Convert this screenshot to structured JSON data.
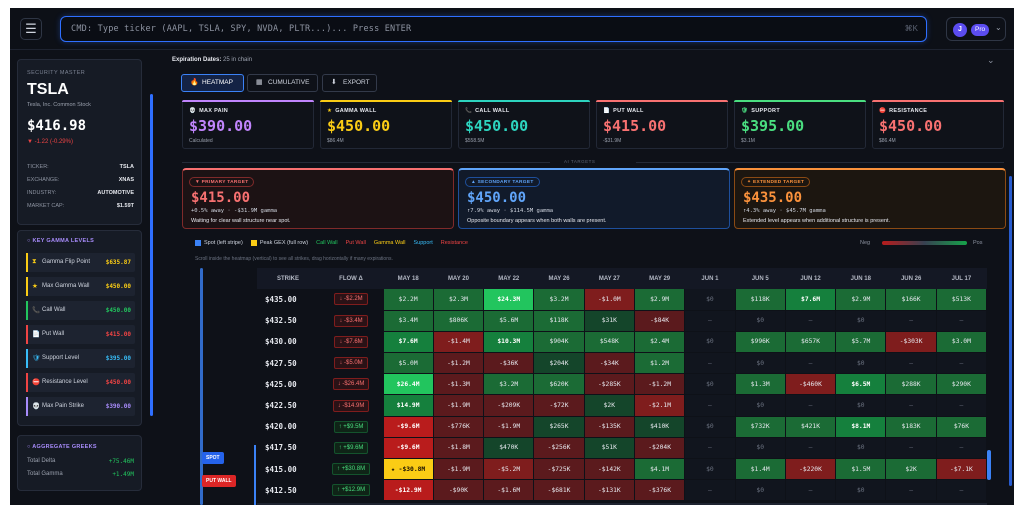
{
  "topbar": {
    "menu_icon": "hamburger-icon",
    "cmd_placeholder": "CMD: Type ticker (AAPL, TSLA, SPY, NVDA, PLTR...)... Press ENTER",
    "cmd_shortcut": "⌘K",
    "avatar": "J",
    "plan": "Pro"
  },
  "security": {
    "heading": "SECURITY MASTER",
    "ticker": "TSLA",
    "company": "Tesla, Inc. Common Stock",
    "price": "$416.98",
    "change": "▼ -1.22 (-0.29%)",
    "rows": [
      {
        "label": "TICKER:",
        "value": "TSLA"
      },
      {
        "label": "EXCHANGE:",
        "value": "XNAS"
      },
      {
        "label": "INDUSTRY:",
        "value": "AUTOMOTIVE"
      },
      {
        "label": "MARKET CAP:",
        "value": "$1.59T"
      }
    ]
  },
  "levels": {
    "heading": "KEY GAMMA LEVELS",
    "items": [
      {
        "icon": "⧗",
        "label": "Gamma Flip Point",
        "value": "$635.87",
        "color": "#facc15"
      },
      {
        "icon": "★",
        "label": "Max Gamma Wall",
        "value": "$450.00",
        "color": "#facc15"
      },
      {
        "icon": "📞",
        "label": "Call Wall",
        "value": "$450.00",
        "color": "#22c55e"
      },
      {
        "icon": "📄",
        "label": "Put Wall",
        "value": "$415.00",
        "color": "#ef4444"
      },
      {
        "icon": "🛡",
        "label": "Support Level",
        "value": "$395.00",
        "color": "#38bdf8"
      },
      {
        "icon": "⛔",
        "label": "Resistance Level",
        "value": "$450.00",
        "color": "#ef4444"
      },
      {
        "icon": "💀",
        "label": "Max Pain Strike",
        "value": "$390.00",
        "color": "#a78bfa"
      }
    ]
  },
  "greeks": {
    "heading": "AGGREGATE GREEKS",
    "rows": [
      {
        "label": "Total Delta",
        "value": "+75.46M"
      },
      {
        "label": "Total Gamma",
        "value": "+1.49M"
      }
    ]
  },
  "main": {
    "exp_label": "Expiration Dates:",
    "exp_value": "25 in chain",
    "tabs": [
      {
        "label": "HEATMAP",
        "icon": "flame-icon"
      },
      {
        "label": "CUMULATIVE",
        "icon": "bar-chart-icon"
      },
      {
        "label": "EXPORT",
        "icon": "export-icon"
      }
    ]
  },
  "cards": [
    {
      "title": "MAX PAIN",
      "icon": "💀",
      "value": "$390.00",
      "sub": "Calculated",
      "color": "#c084fc"
    },
    {
      "title": "GAMMA WALL",
      "icon": "★",
      "value": "$450.00",
      "sub": "$86.4M",
      "color": "#facc15"
    },
    {
      "title": "CALL WALL",
      "icon": "📞",
      "value": "$450.00",
      "sub": "$558.5M",
      "color": "#2dd4bf"
    },
    {
      "title": "PUT WALL",
      "icon": "📄",
      "value": "$415.00",
      "sub": "-$31.9M",
      "color": "#f87171"
    },
    {
      "title": "SUPPORT",
      "icon": "🛡",
      "value": "$395.00",
      "sub": "$3.1M",
      "color": "#4ade80"
    },
    {
      "title": "RESISTANCE",
      "icon": "⛔",
      "value": "$450.00",
      "sub": "$86.4M",
      "color": "#f87171"
    }
  ],
  "ai_divider": "AI TARGETS",
  "targets": [
    {
      "badge": "▼ PRIMARY TARGET",
      "value": "$415.00",
      "meta": "+0.5% away · -$31.9M gamma",
      "desc": "Waiting for clear wall structure near spot.",
      "color": "#f87171",
      "border": "#7f2a2a",
      "bg": "#1c1214"
    },
    {
      "badge": "▲ SECONDARY TARGET",
      "value": "$450.00",
      "meta": "↑7.9% away · $114.5M gamma",
      "desc": "Opposite boundary appears when both walls are present.",
      "color": "#60a5fa",
      "border": "#1e4f9c",
      "bg": "#111a2a"
    },
    {
      "badge": "✦ EXTENDED TARGET",
      "value": "$435.00",
      "meta": "↑4.3% away · $45.7M gamma",
      "desc": "Extended level appears when additional structure is present.",
      "color": "#fb923c",
      "border": "#8a4a14",
      "bg": "#1c1610"
    }
  ],
  "legend": {
    "items": [
      {
        "label": "Spot (left stripe)",
        "color": "#3b82f6",
        "text": "#cfd4de"
      },
      {
        "label": "Peak GEX (full row)",
        "color": "#facc15",
        "text": "#cfd4de"
      },
      {
        "label": "Call Wall",
        "color": "",
        "text": "#22c55e"
      },
      {
        "label": "Put Wall",
        "color": "",
        "text": "#ef4444"
      },
      {
        "label": "Gamma Wall",
        "color": "",
        "text": "#facc15"
      },
      {
        "label": "Support",
        "color": "",
        "text": "#38bdf8"
      },
      {
        "label": "Resistance",
        "color": "",
        "text": "#ef4444"
      }
    ],
    "neg": "Neg",
    "pos": "Pos",
    "hint": "Scroll inside the heatmap (vertical) to see all strikes, drag horizontally if many expirations."
  },
  "markers": {
    "spot": "SPOT",
    "put_wall": "PUT WALL"
  },
  "heatmap": {
    "headers": [
      "STRIKE",
      "FLOW Δ",
      "MAY 18",
      "MAY 20",
      "MAY 22",
      "MAY 26",
      "MAY 27",
      "MAY 29",
      "JUN 1",
      "JUN 5",
      "JUN 12",
      "JUN 18",
      "JUN 26",
      "JUL 17"
    ],
    "rows": [
      {
        "strike": "$435.00",
        "flow": "↓ -$2.2M",
        "flow_dir": "neg",
        "cells": [
          [
            "$2.2M",
            "g2"
          ],
          [
            "$2.3M",
            "g2"
          ],
          [
            "$24.3M",
            "g4"
          ],
          [
            "$3.2M",
            "g2"
          ],
          [
            "-$1.0M",
            "r2"
          ],
          [
            "$2.9M",
            "g2"
          ],
          [
            "$0",
            "n"
          ],
          [
            "$118K",
            "g2"
          ],
          [
            "$7.6M",
            "g3"
          ],
          [
            "$2.9M",
            "g2"
          ],
          [
            "$166K",
            "g2"
          ],
          [
            "$513K",
            "g2"
          ]
        ]
      },
      {
        "strike": "$432.50",
        "flow": "↓ -$3.4M",
        "flow_dir": "neg",
        "cells": [
          [
            "$3.4M",
            "g2"
          ],
          [
            "$806K",
            "g2"
          ],
          [
            "$5.6M",
            "g2"
          ],
          [
            "$118K",
            "g2"
          ],
          [
            "$31K",
            "g1"
          ],
          [
            "-$84K",
            "r1"
          ],
          [
            "—",
            "n"
          ],
          [
            "$0",
            "n"
          ],
          [
            "—",
            "n"
          ],
          [
            "$0",
            "n"
          ],
          [
            "—",
            "n"
          ],
          [
            "—",
            "n"
          ]
        ]
      },
      {
        "strike": "$430.00",
        "flow": "↓ -$7.6M",
        "flow_dir": "neg",
        "cells": [
          [
            "$7.6M",
            "g3"
          ],
          [
            "-$1.4M",
            "r2"
          ],
          [
            "$10.3M",
            "g3"
          ],
          [
            "$904K",
            "g2"
          ],
          [
            "$548K",
            "g2"
          ],
          [
            "$2.4M",
            "g2"
          ],
          [
            "$0",
            "n"
          ],
          [
            "$996K",
            "g2"
          ],
          [
            "$657K",
            "g2"
          ],
          [
            "$5.7M",
            "g2"
          ],
          [
            "-$303K",
            "r2"
          ],
          [
            "$3.0M",
            "g2"
          ]
        ]
      },
      {
        "strike": "$427.50",
        "flow": "↓ -$5.0M",
        "flow_dir": "neg",
        "cells": [
          [
            "$5.0M",
            "g2"
          ],
          [
            "-$1.2M",
            "r1"
          ],
          [
            "-$36K",
            "r1"
          ],
          [
            "$204K",
            "g1"
          ],
          [
            "-$34K",
            "r1"
          ],
          [
            "$1.2M",
            "g2"
          ],
          [
            "—",
            "n"
          ],
          [
            "$0",
            "n"
          ],
          [
            "—",
            "n"
          ],
          [
            "$0",
            "n"
          ],
          [
            "—",
            "n"
          ],
          [
            "—",
            "n"
          ]
        ]
      },
      {
        "strike": "$425.00",
        "flow": "↓ -$26.4M",
        "flow_dir": "neg",
        "cells": [
          [
            "$26.4M",
            "g4"
          ],
          [
            "-$1.3M",
            "r1"
          ],
          [
            "$3.2M",
            "g2"
          ],
          [
            "$620K",
            "g2"
          ],
          [
            "-$285K",
            "r1"
          ],
          [
            "-$1.2M",
            "r1"
          ],
          [
            "$0",
            "n"
          ],
          [
            "$1.3M",
            "g2"
          ],
          [
            "-$460K",
            "r2"
          ],
          [
            "$6.5M",
            "g3"
          ],
          [
            "$288K",
            "g2"
          ],
          [
            "$290K",
            "g2"
          ]
        ]
      },
      {
        "strike": "$422.50",
        "flow": "↓ -$14.9M",
        "flow_dir": "neg",
        "cells": [
          [
            "$14.9M",
            "g3"
          ],
          [
            "-$1.9M",
            "r1"
          ],
          [
            "-$209K",
            "r1"
          ],
          [
            "-$72K",
            "r1"
          ],
          [
            "$2K",
            "g1"
          ],
          [
            "-$2.1M",
            "r2"
          ],
          [
            "—",
            "n"
          ],
          [
            "$0",
            "n"
          ],
          [
            "—",
            "n"
          ],
          [
            "$0",
            "n"
          ],
          [
            "—",
            "n"
          ],
          [
            "—",
            "n"
          ]
        ]
      },
      {
        "strike": "$420.00",
        "flow": "↑ +$9.5M",
        "flow_dir": "pos",
        "cells": [
          [
            "-$9.6M",
            "r3"
          ],
          [
            "-$776K",
            "r1"
          ],
          [
            "-$1.9M",
            "r1"
          ],
          [
            "$265K",
            "g1"
          ],
          [
            "-$135K",
            "r1"
          ],
          [
            "$410K",
            "g1"
          ],
          [
            "$0",
            "n"
          ],
          [
            "$732K",
            "g2"
          ],
          [
            "$421K",
            "g2"
          ],
          [
            "$8.1M",
            "g3"
          ],
          [
            "$183K",
            "g2"
          ],
          [
            "$76K",
            "g2"
          ]
        ]
      },
      {
        "strike": "$417.50",
        "flow": "↑ +$9.6M",
        "flow_dir": "pos",
        "cells": [
          [
            "-$9.6M",
            "r3"
          ],
          [
            "-$1.8M",
            "r1"
          ],
          [
            "$470K",
            "g1"
          ],
          [
            "-$256K",
            "r1"
          ],
          [
            "$51K",
            "g1"
          ],
          [
            "-$204K",
            "r1"
          ],
          [
            "—",
            "n"
          ],
          [
            "$0",
            "n"
          ],
          [
            "—",
            "n"
          ],
          [
            "$0",
            "n"
          ],
          [
            "—",
            "n"
          ],
          [
            "—",
            "n"
          ]
        ]
      },
      {
        "strike": "$415.00",
        "flow": "↑ +$30.8M",
        "flow_dir": "pos",
        "cells": [
          [
            "★ -$30.8M",
            "y"
          ],
          [
            "-$1.9M",
            "r1"
          ],
          [
            "-$5.2M",
            "r2"
          ],
          [
            "-$725K",
            "r1"
          ],
          [
            "-$142K",
            "r1"
          ],
          [
            "$4.1M",
            "g2"
          ],
          [
            "$0",
            "n"
          ],
          [
            "$1.4M",
            "g2"
          ],
          [
            "-$220K",
            "r2"
          ],
          [
            "$1.5M",
            "g2"
          ],
          [
            "$2K",
            "g2"
          ],
          [
            "-$7.1K",
            "r2"
          ]
        ]
      },
      {
        "strike": "$412.50",
        "flow": "↑ +$12.9M",
        "flow_dir": "pos",
        "cells": [
          [
            "-$12.9M",
            "r3"
          ],
          [
            "-$90K",
            "r1"
          ],
          [
            "-$1.6M",
            "r1"
          ],
          [
            "-$681K",
            "r1"
          ],
          [
            "-$131K",
            "r1"
          ],
          [
            "-$376K",
            "r1"
          ],
          [
            "—",
            "n"
          ],
          [
            "$0",
            "n"
          ],
          [
            "—",
            "n"
          ],
          [
            "$0",
            "n"
          ],
          [
            "—",
            "n"
          ],
          [
            "—",
            "n"
          ]
        ]
      }
    ]
  }
}
